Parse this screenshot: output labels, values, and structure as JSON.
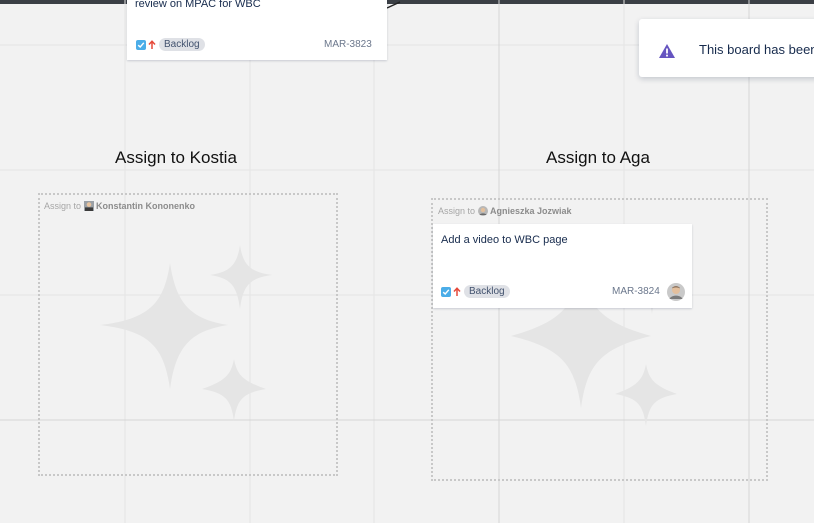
{
  "cards": [
    {
      "title": "review on MPAC for WBC",
      "status": "Backlog",
      "key": "MAR-3823",
      "type_icon": "checkbox-icon",
      "priority_icon": "priority-high-arrow-icon"
    },
    {
      "title": "Add a video to WBC page",
      "status": "Backlog",
      "key": "MAR-3824",
      "type_icon": "checkbox-icon",
      "priority_icon": "priority-high-arrow-icon",
      "avatar": "user-avatar"
    }
  ],
  "sections": [
    {
      "heading": "Assign to Kostia",
      "label_prefix": "Assign to",
      "assignee": "Konstantin Kononenko"
    },
    {
      "heading": "Assign to Aga",
      "label_prefix": "Assign to",
      "assignee": "Agnieszka Jozwiak"
    }
  ],
  "banner": {
    "text": "This board has been",
    "icon": "warning-triangle-icon"
  },
  "colors": {
    "accent_blue": "#4bade8",
    "priority_red": "#e5493a",
    "warning_purple": "#6554c0",
    "canvas": "#f2f2f2",
    "lozenge": "#dfe1e6"
  }
}
